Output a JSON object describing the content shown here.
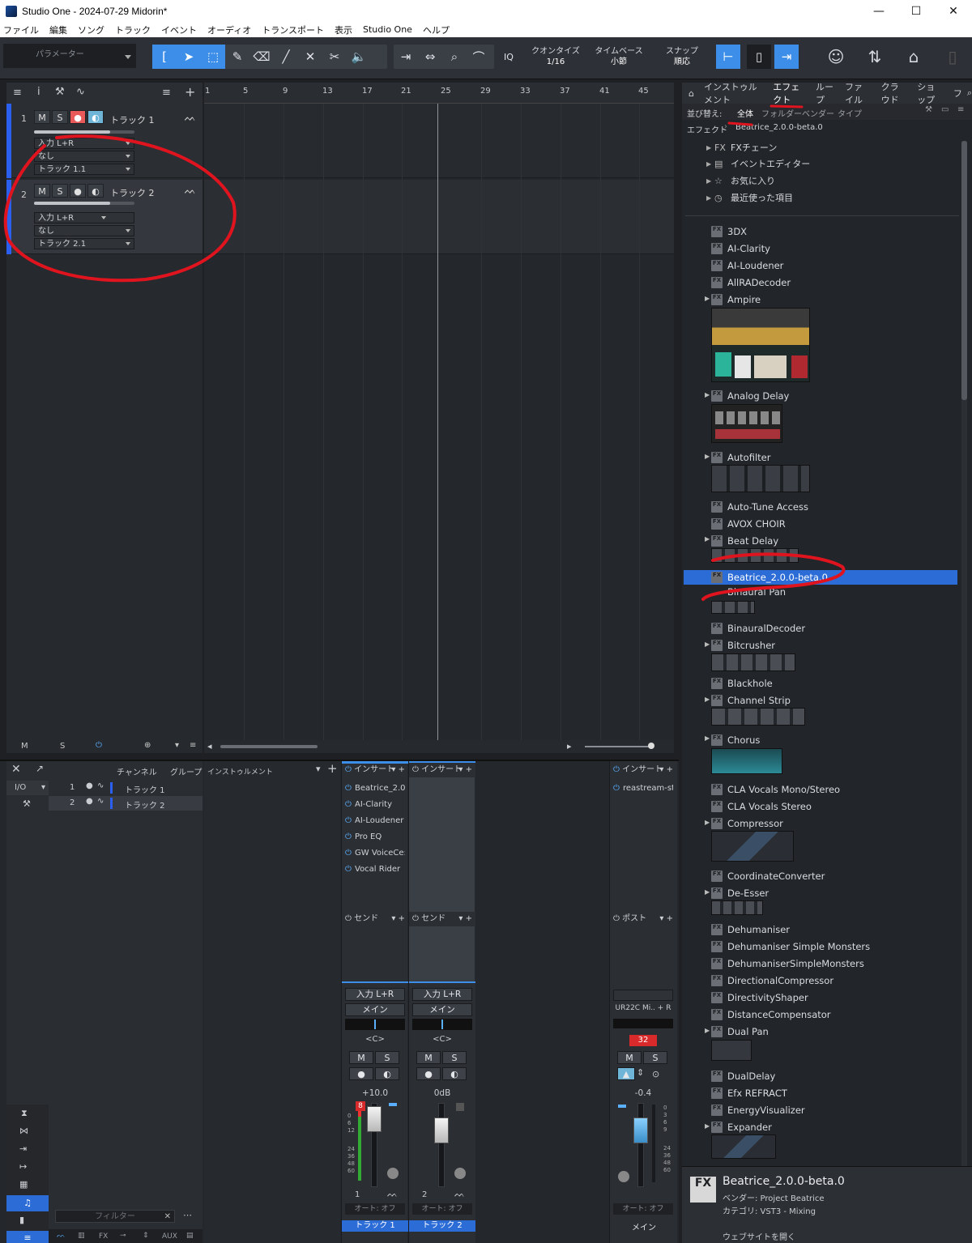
{
  "window": {
    "title": "Studio One - 2024-07-29 Midorin*",
    "minimize": "—",
    "maximize": "☐",
    "close": "✕"
  },
  "menu": [
    "ファイル",
    "編集",
    "ソング",
    "トラック",
    "イベント",
    "オーディオ",
    "トランスポート",
    "表示",
    "Studio One",
    "ヘルプ"
  ],
  "toolbar": {
    "parameter_label": "パラメーター",
    "iq": "IQ",
    "quantize_label": "クオンタイズ",
    "quantize_value": "1/16",
    "timebase_label": "タイムベース",
    "timebase_value": "小節",
    "snap_label": "スナップ",
    "snap_value": "順応"
  },
  "ruler": {
    "marks": [
      "1",
      "5",
      "9",
      "13",
      "17",
      "21",
      "25",
      "29",
      "33",
      "37",
      "41",
      "45"
    ]
  },
  "tracks": [
    {
      "number": "1",
      "mute": "M",
      "solo": "S",
      "name": "トラック 1",
      "input": "入力 L+R",
      "output": "なし",
      "sub": "トラック 1.1"
    },
    {
      "number": "2",
      "mute": "M",
      "solo": "S",
      "name": "トラック 2",
      "input": "入力 L+R",
      "output": "なし",
      "sub": "トラック 2.1"
    }
  ],
  "track_footer": {
    "m": "M",
    "s": "S"
  },
  "browser": {
    "tabs": [
      "インストゥルメント",
      "エフェクト",
      "ループ",
      "ファイル",
      "クラウド",
      "ショップ",
      "フ"
    ],
    "sort_label": "並び替え:",
    "sort_options": [
      "全体",
      "フォルダー",
      "ベンダー",
      "タイプ"
    ],
    "breadcrumb_root": "エフェクト",
    "breadcrumb_current": "Beatrice_2.0.0-beta.0",
    "folders": [
      "FXチェーン",
      "イベントエディター",
      "お気に入り",
      "最近使った項目"
    ],
    "plugins": [
      "3DX",
      "AI-Clarity",
      "AI-Loudener",
      "AllRADecoder",
      "Ampire",
      "Analog Delay",
      "Autofilter",
      "Auto-Tune Access",
      "AVOX CHOIR",
      "Beat Delay",
      "Beatrice_2.0.0-beta.0",
      "Binaural Pan",
      "BinauralDecoder",
      "Bitcrusher",
      "Blackhole",
      "Channel Strip",
      "Chorus",
      "CLA Vocals Mono/Stereo",
      "CLA Vocals Stereo",
      "Compressor",
      "CoordinateConverter",
      "De-Esser",
      "Dehumaniser",
      "Dehumaniser Simple Monsters",
      "DehumaniserSimpleMonsters",
      "DirectionalCompressor",
      "DirectivityShaper",
      "DistanceCompensator",
      "Dual Pan",
      "DualDelay",
      "Efx REFRACT",
      "EnergyVisualizer",
      "Expander"
    ],
    "info": {
      "name": "Beatrice_2.0.0-beta.0",
      "vendor": "ベンダー:  Project Beatrice",
      "category": "カテゴリ:  VST3 - Mixing",
      "website": "ウェブサイトを開く"
    }
  },
  "console": {
    "header_channel": "チャンネル",
    "header_group": "グループ",
    "io_label": "I/O",
    "list": [
      {
        "num": "1",
        "name": "トラック 1"
      },
      {
        "num": "2",
        "name": "トラック 2"
      }
    ],
    "filter_placeholder": "フィルター",
    "instrument_header": "インストゥルメント",
    "bottom_tabs": [
      "FX",
      "AUX"
    ],
    "strips": [
      {
        "insert_label": "インサート",
        "inserts": [
          "Beatrice_2.0.",
          "AI-Clarity",
          "AI-Loudener",
          "Pro EQ",
          "GW VoiceCe:",
          "Vocal Rider"
        ],
        "send_label": "センド",
        "input": "入力 L+R",
        "output": "メイン",
        "pan": "<C>",
        "mute": "M",
        "solo": "S",
        "gain": "+10.0",
        "peak": "8",
        "num": "1",
        "auto": "オート: オフ",
        "name": "トラック 1"
      },
      {
        "insert_label": "インサート",
        "inserts": [],
        "send_label": "センド",
        "input": "入力 L+R",
        "output": "メイン",
        "pan": "<C>",
        "mute": "M",
        "solo": "S",
        "gain": "0dB",
        "num": "2",
        "auto": "オート: オフ",
        "name": "トラック 2"
      }
    ],
    "main": {
      "insert_label": "インサート",
      "inserts": [
        "reastream-st"
      ],
      "post_label": "ポスト",
      "device": "UR22C Mi.. + R",
      "peak": "32",
      "mute": "M",
      "solo": "S",
      "gain": "-0.4",
      "auto": "オート: オフ",
      "name": "メイン"
    },
    "scale_left": [
      "0",
      "6",
      "12",
      "24",
      "36",
      "48",
      "60"
    ],
    "scale_main": [
      "0",
      "3",
      "6",
      "9",
      "24",
      "36",
      "48",
      "60"
    ]
  },
  "colors": {
    "accent": "#3d8ee8",
    "record": "#e85a5a",
    "monitor": "#6fb5d8",
    "selection": "#2c6cd6",
    "annotation": "#e0141e"
  }
}
